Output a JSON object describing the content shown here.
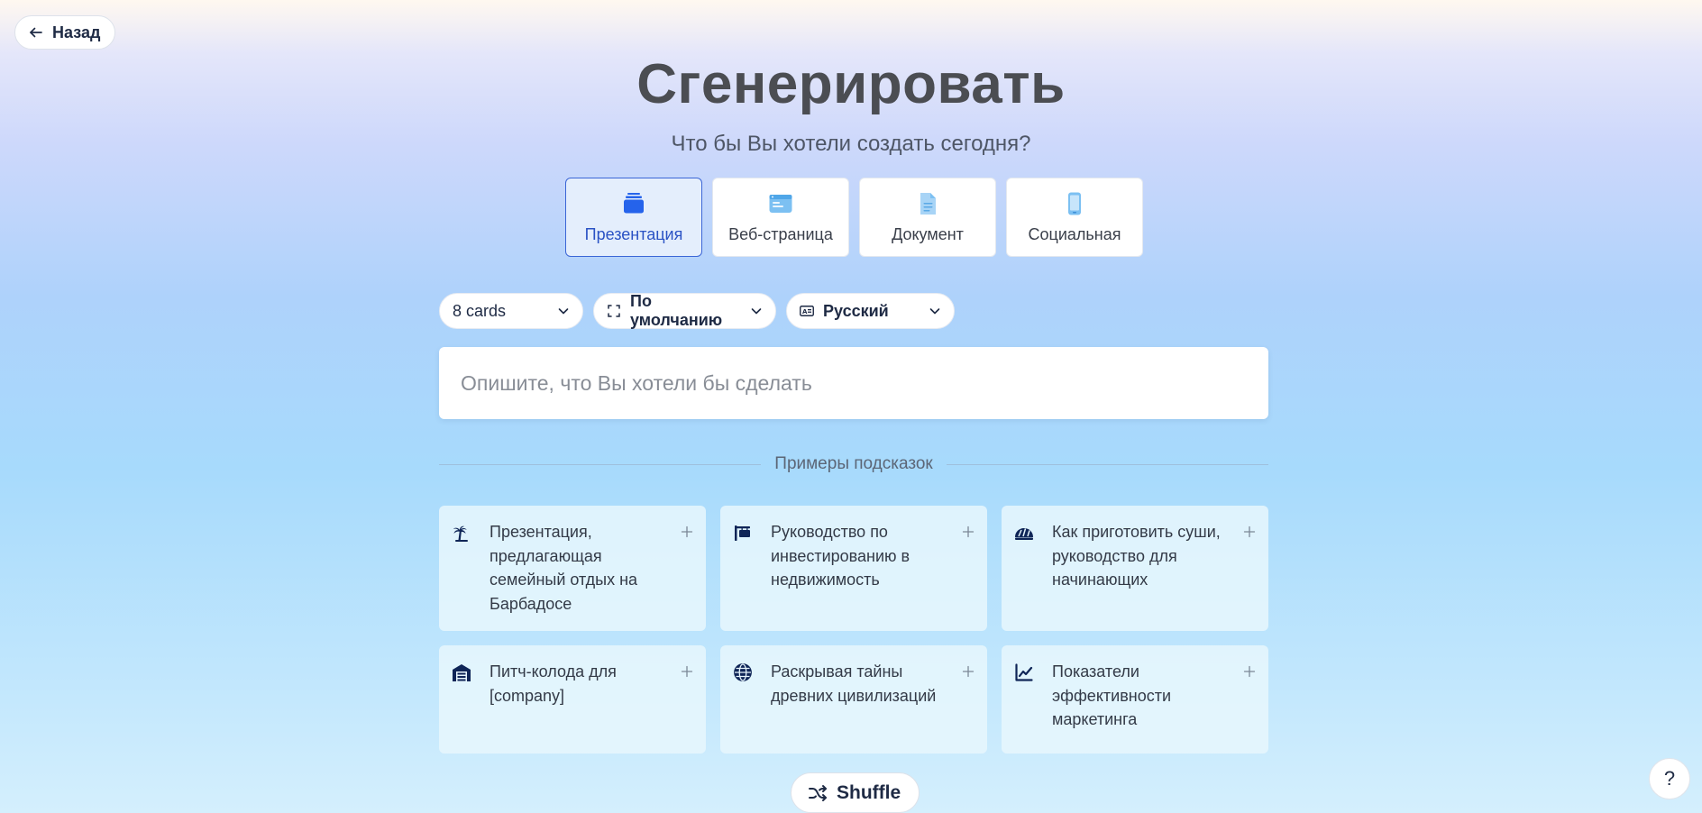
{
  "back_label": "Назад",
  "title": "Сгенерировать",
  "subtitle": "Что бы Вы хотели создать сегодня?",
  "types": [
    {
      "label": "Презентация",
      "icon": "presentation-icon",
      "active": true
    },
    {
      "label": "Веб-страница",
      "icon": "webpage-icon",
      "active": false
    },
    {
      "label": "Документ",
      "icon": "document-icon",
      "active": false
    },
    {
      "label": "Социальная",
      "icon": "social-phone-icon",
      "active": false
    }
  ],
  "options": {
    "cards": "8 cards",
    "format": "По умолчанию",
    "language": "Русский"
  },
  "prompt": {
    "placeholder": "Опишите, что Вы хотели бы сделать",
    "value": ""
  },
  "examples_label": "Примеры подсказок",
  "examples": [
    {
      "text": "Презентация, предлагающая семейный отдых на Барбадосе",
      "icon": "island-icon"
    },
    {
      "text": "Руководство по инвестированию в недвижимость",
      "icon": "sign-icon"
    },
    {
      "text": "Как приготовить суши, руководство для начинающих",
      "icon": "sushi-icon"
    },
    {
      "text": "Питч-колода для [company]",
      "icon": "warehouse-icon"
    },
    {
      "text": "Раскрывая тайны древних цивилизаций",
      "icon": "globe-icon"
    },
    {
      "text": "Показатели эффективности маркетинга",
      "icon": "chart-line-icon"
    }
  ],
  "shuffle_label": "Shuffle",
  "help_label": "?",
  "colors": {
    "accent": "#2a52c4",
    "accent_bg": "#e4eefc",
    "icon_light": "#7cc0f2",
    "icon_dark": "#0f2557",
    "text_dark": "#1e2a44"
  }
}
